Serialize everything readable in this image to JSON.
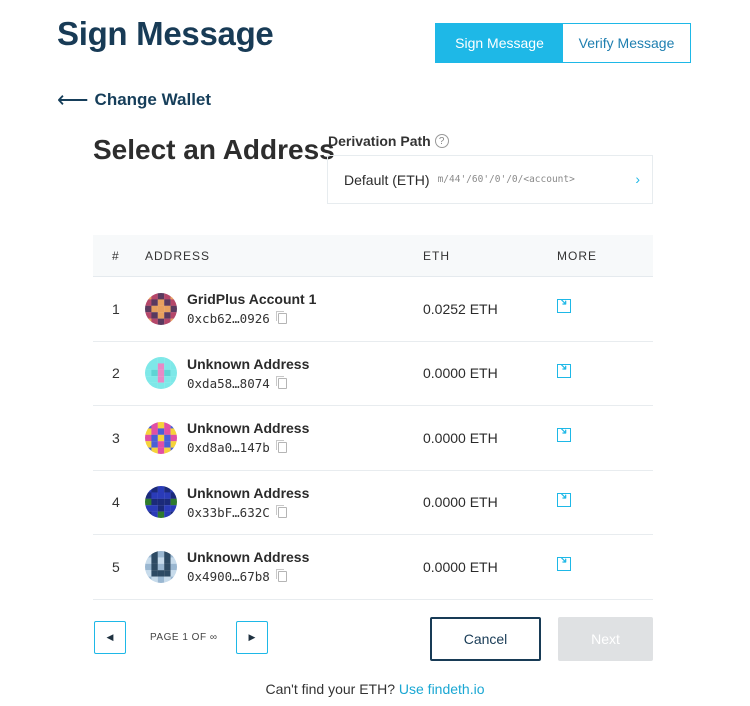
{
  "header": {
    "title": "Sign Message",
    "tabs": [
      {
        "label": "Sign Message",
        "active": true
      },
      {
        "label": "Verify Message",
        "active": false
      }
    ]
  },
  "nav": {
    "back_label": "Change Wallet"
  },
  "select": {
    "title": "Select an Address",
    "derivation_label": "Derivation Path",
    "derivation_value": "Default (ETH)",
    "derivation_path": "m/44'/60'/0'/0/<account>"
  },
  "table": {
    "headers": [
      "#",
      "ADDRESS",
      "ETH",
      "MORE"
    ],
    "rows": [
      {
        "index": "1",
        "name": "GridPlus Account 1",
        "address": "0xcb62…0926",
        "balance": "0.0252 ETH",
        "avatar_colors": [
          "#b5476a",
          "#e7a05e",
          "#5a3a5f"
        ]
      },
      {
        "index": "2",
        "name": "Unknown Address",
        "address": "0xda58…8074",
        "balance": "0.0000 ETH",
        "avatar_colors": [
          "#7ee8e8",
          "#e889c6",
          "#5ed4d4"
        ]
      },
      {
        "index": "3",
        "name": "Unknown Address",
        "address": "0xd8a0…147b",
        "balance": "0.0000 ETH",
        "avatar_colors": [
          "#f5d33a",
          "#e04fa5",
          "#4a5fd6"
        ]
      },
      {
        "index": "4",
        "name": "Unknown Address",
        "address": "0x33bF…632C",
        "balance": "0.0000 ETH",
        "avatar_colors": [
          "#2a3bb8",
          "#2e7a2e",
          "#1b2a7a"
        ]
      },
      {
        "index": "5",
        "name": "Unknown Address",
        "address": "0x4900…67b8",
        "balance": "0.0000 ETH",
        "avatar_colors": [
          "#9ab7d1",
          "#2d4a63",
          "#c7dbeb"
        ]
      }
    ]
  },
  "pager": {
    "text": "PAGE 1 OF ∞",
    "prev_glyph": "◀",
    "next_glyph": "▶"
  },
  "actions": {
    "cancel": "Cancel",
    "next": "Next"
  },
  "footer": {
    "text": "Can't find your ETH?",
    "link": "Use findeth.io"
  },
  "colors": {
    "accent": "#1eb8e7",
    "navy": "#183b56"
  }
}
